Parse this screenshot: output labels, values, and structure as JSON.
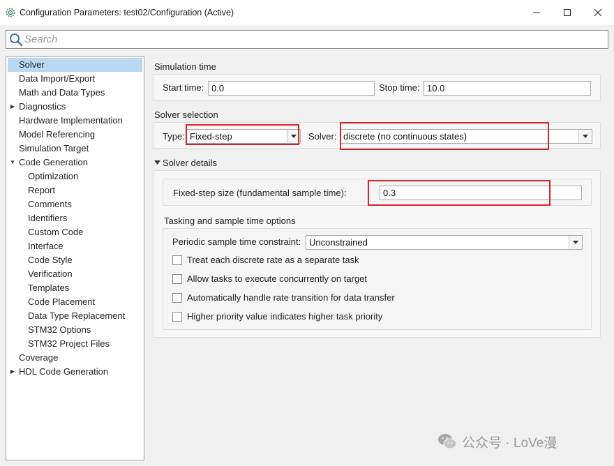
{
  "window": {
    "title": "Configuration Parameters: test02/Configuration (Active)",
    "app_icon": "matlab-gear-icon"
  },
  "window_controls": {
    "minimize": "─",
    "maximize": "☐",
    "close": "✕"
  },
  "search": {
    "placeholder": "Search",
    "value": ""
  },
  "tree": {
    "selected": "Solver",
    "items": [
      {
        "label": "Solver",
        "level": 0,
        "expander": "",
        "selected": true
      },
      {
        "label": "Data Import/Export",
        "level": 0,
        "expander": ""
      },
      {
        "label": "Math and Data Types",
        "level": 0,
        "expander": ""
      },
      {
        "label": "Diagnostics",
        "level": 0,
        "expander": "collapsed"
      },
      {
        "label": "Hardware Implementation",
        "level": 0,
        "expander": ""
      },
      {
        "label": "Model Referencing",
        "level": 0,
        "expander": ""
      },
      {
        "label": "Simulation Target",
        "level": 0,
        "expander": ""
      },
      {
        "label": "Code Generation",
        "level": 0,
        "expander": "expanded"
      },
      {
        "label": "Optimization",
        "level": 1,
        "expander": ""
      },
      {
        "label": "Report",
        "level": 1,
        "expander": ""
      },
      {
        "label": "Comments",
        "level": 1,
        "expander": ""
      },
      {
        "label": "Identifiers",
        "level": 1,
        "expander": ""
      },
      {
        "label": "Custom Code",
        "level": 1,
        "expander": ""
      },
      {
        "label": "Interface",
        "level": 1,
        "expander": ""
      },
      {
        "label": "Code Style",
        "level": 1,
        "expander": ""
      },
      {
        "label": "Verification",
        "level": 1,
        "expander": ""
      },
      {
        "label": "Templates",
        "level": 1,
        "expander": ""
      },
      {
        "label": "Code Placement",
        "level": 1,
        "expander": ""
      },
      {
        "label": "Data Type Replacement",
        "level": 1,
        "expander": ""
      },
      {
        "label": "STM32 Options",
        "level": 1,
        "expander": ""
      },
      {
        "label": "STM32 Project Files",
        "level": 1,
        "expander": ""
      },
      {
        "label": "Coverage",
        "level": 0,
        "expander": ""
      },
      {
        "label": "HDL Code Generation",
        "level": 0,
        "expander": "collapsed"
      }
    ]
  },
  "simulation_time": {
    "title": "Simulation time",
    "start_label": "Start time:",
    "start_value": "0.0",
    "stop_label": "Stop time:",
    "stop_value": "10.0"
  },
  "solver_selection": {
    "title": "Solver selection",
    "type_label": "Type:",
    "type_value": "Fixed-step",
    "solver_label": "Solver:",
    "solver_value": "discrete (no continuous states)"
  },
  "solver_details": {
    "title": "Solver details",
    "fixed_step_label": "Fixed-step size (fundamental sample time):",
    "fixed_step_value": "0.3"
  },
  "tasking": {
    "title": "Tasking and sample time options",
    "constraint_label": "Periodic sample time constraint:",
    "constraint_value": "Unconstrained",
    "checkboxes": [
      {
        "label": "Treat each discrete rate as a separate task",
        "checked": false
      },
      {
        "label": "Allow tasks to execute concurrently on target",
        "checked": false
      },
      {
        "label": "Automatically handle rate transition for data transfer",
        "checked": false
      },
      {
        "label": "Higher priority value indicates higher task priority",
        "checked": false
      }
    ]
  },
  "watermark": {
    "text": "公众号 · LoVe漫",
    "icon": "wechat-icon"
  },
  "colors": {
    "selection": "#b9d9f3",
    "highlight_box": "#d6232a",
    "panel_bg": "#f0f0f0"
  }
}
